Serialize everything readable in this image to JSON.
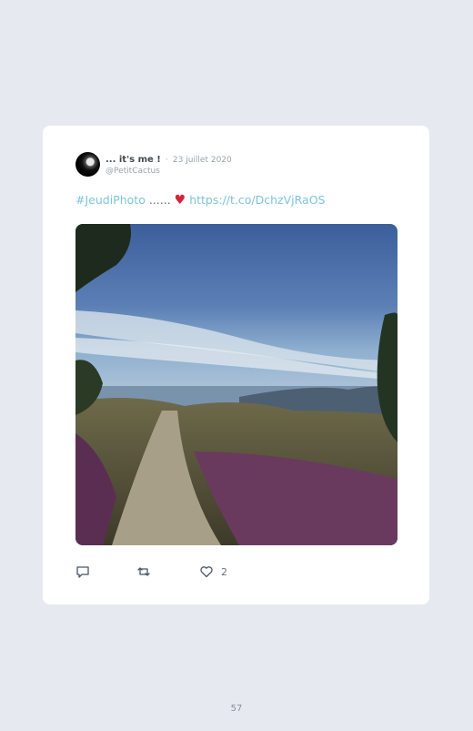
{
  "tweet": {
    "author_name": "... it's me !",
    "separator": "·",
    "date": "23 juillet 2020",
    "handle": "@PetitCactus",
    "hashtag": "#JeudiPhoto",
    "dots": "......",
    "heart": "♥",
    "link": "https://t.co/DchzVjRaOS",
    "likes": "2"
  },
  "page": {
    "number": "57"
  },
  "icons": [
    "reply-icon",
    "retweet-icon",
    "like-icon"
  ]
}
